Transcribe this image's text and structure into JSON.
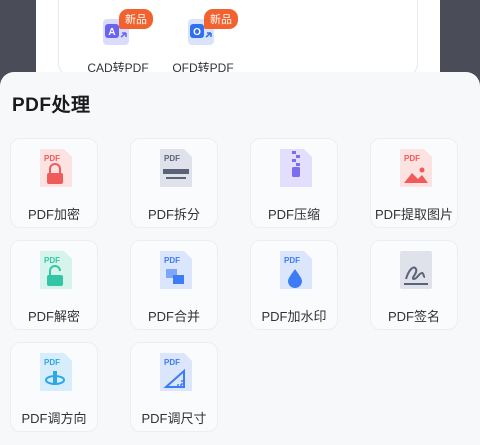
{
  "top": {
    "items": [
      {
        "label": "CAD转PDF",
        "badge": "新品",
        "icon": "cad-to-pdf-icon",
        "letter": "A"
      },
      {
        "label": "OFD转PDF",
        "badge": "新品",
        "icon": "ofd-to-pdf-icon",
        "letter": "O"
      }
    ]
  },
  "sheet": {
    "title": "PDF处理",
    "doc_tag": "PDF",
    "tools": [
      {
        "label": "PDF加密",
        "icon": "lock-icon",
        "color": "#f05a5a"
      },
      {
        "label": "PDF拆分",
        "icon": "split-icon",
        "color": "#5a6378"
      },
      {
        "label": "PDF压缩",
        "icon": "zip-icon",
        "color": "#7b6cf0"
      },
      {
        "label": "PDF提取图片",
        "icon": "image-icon",
        "color": "#f05a5a"
      },
      {
        "label": "PDF解密",
        "icon": "unlock-icon",
        "color": "#33c6a6"
      },
      {
        "label": "PDF合并",
        "icon": "merge-icon",
        "color": "#3d7cf5"
      },
      {
        "label": "PDF加水印",
        "icon": "water-drop-icon",
        "color": "#3d7cf5"
      },
      {
        "label": "PDF签名",
        "icon": "signature-icon",
        "color": "#5a6378"
      },
      {
        "label": "PDF调方向",
        "icon": "rotate-icon",
        "color": "#2ea6e8"
      },
      {
        "label": "PDF调尺寸",
        "icon": "ruler-icon",
        "color": "#3d7cf5"
      }
    ]
  }
}
